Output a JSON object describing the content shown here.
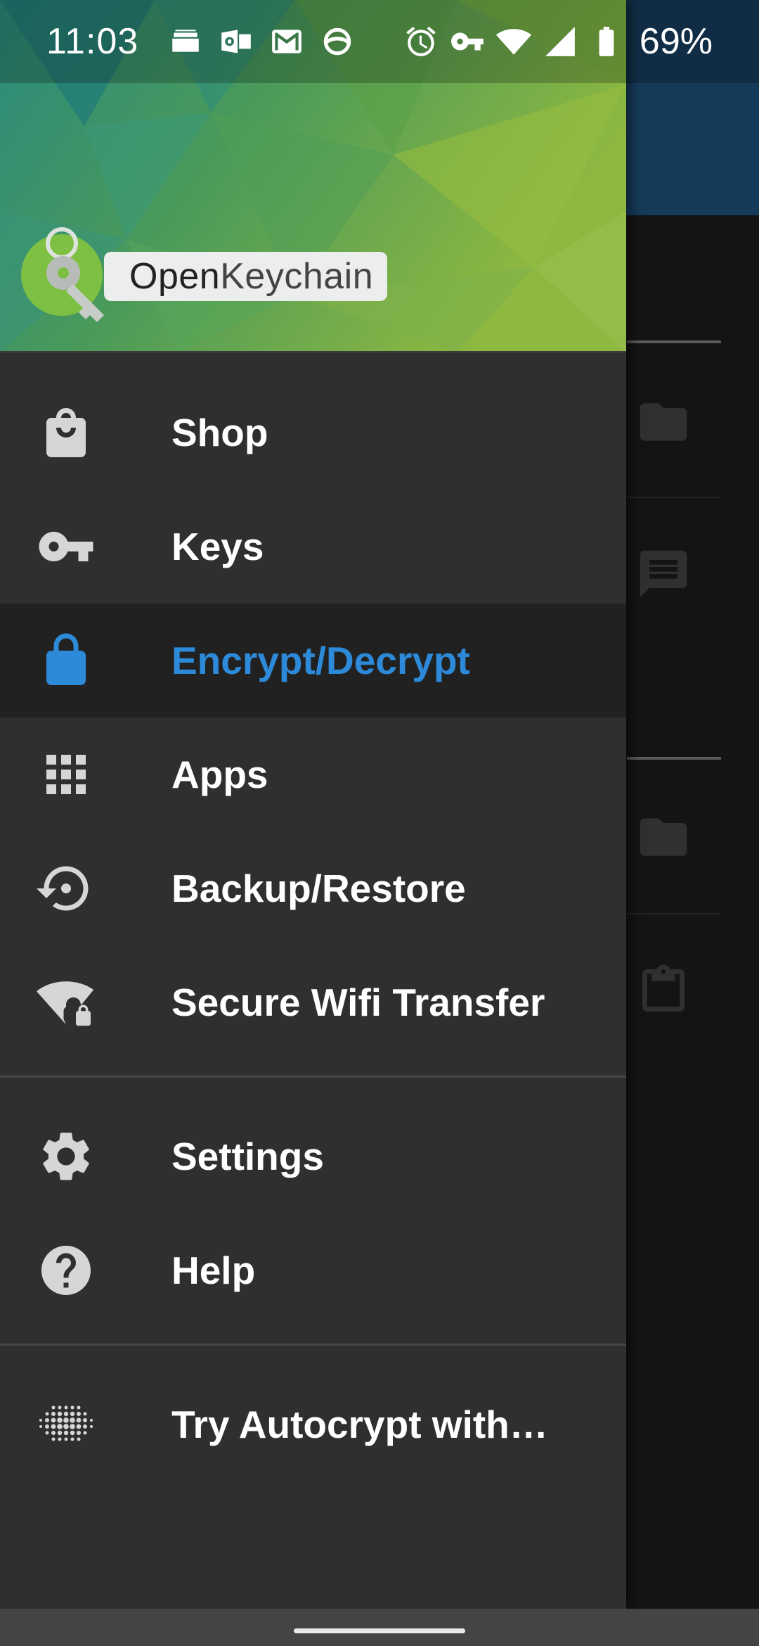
{
  "status_bar": {
    "time": "11:03",
    "battery": "69%",
    "left_icons": [
      "wallet-icon",
      "outlook-icon",
      "gmail-icon",
      "webex-icon"
    ],
    "right_icons": [
      "alarm-icon",
      "vpn-key-icon",
      "wifi-icon",
      "signal-icon",
      "battery-icon"
    ]
  },
  "drawer": {
    "logo": {
      "part1": "Open",
      "part2": "Keychain"
    },
    "primary_items": [
      {
        "label": "Shop",
        "icon": "shopping-bag-icon",
        "active": false
      },
      {
        "label": "Keys",
        "icon": "key-icon",
        "active": false
      },
      {
        "label": "Encrypt/Decrypt",
        "icon": "lock-icon",
        "active": true
      },
      {
        "label": "Apps",
        "icon": "apps-grid-icon",
        "active": false
      },
      {
        "label": "Backup/Restore",
        "icon": "backup-restore-icon",
        "active": false
      },
      {
        "label": "Secure Wifi Transfer",
        "icon": "secure-wifi-icon",
        "active": false
      }
    ],
    "secondary_items": [
      {
        "label": "Settings",
        "icon": "gear-icon"
      },
      {
        "label": "Help",
        "icon": "help-icon"
      }
    ],
    "extra_items": [
      {
        "label": "Try Autocrypt with…",
        "icon": "autocrypt-icon"
      }
    ]
  },
  "background_app": {
    "icons": [
      "folder-icon",
      "message-icon",
      "folder-icon",
      "clipboard-icon"
    ]
  },
  "colors": {
    "drawer_bg": "#2f2f2f",
    "active_bg": "#212121",
    "accent": "#2d8ad9",
    "app_bar": "#163a5a"
  }
}
